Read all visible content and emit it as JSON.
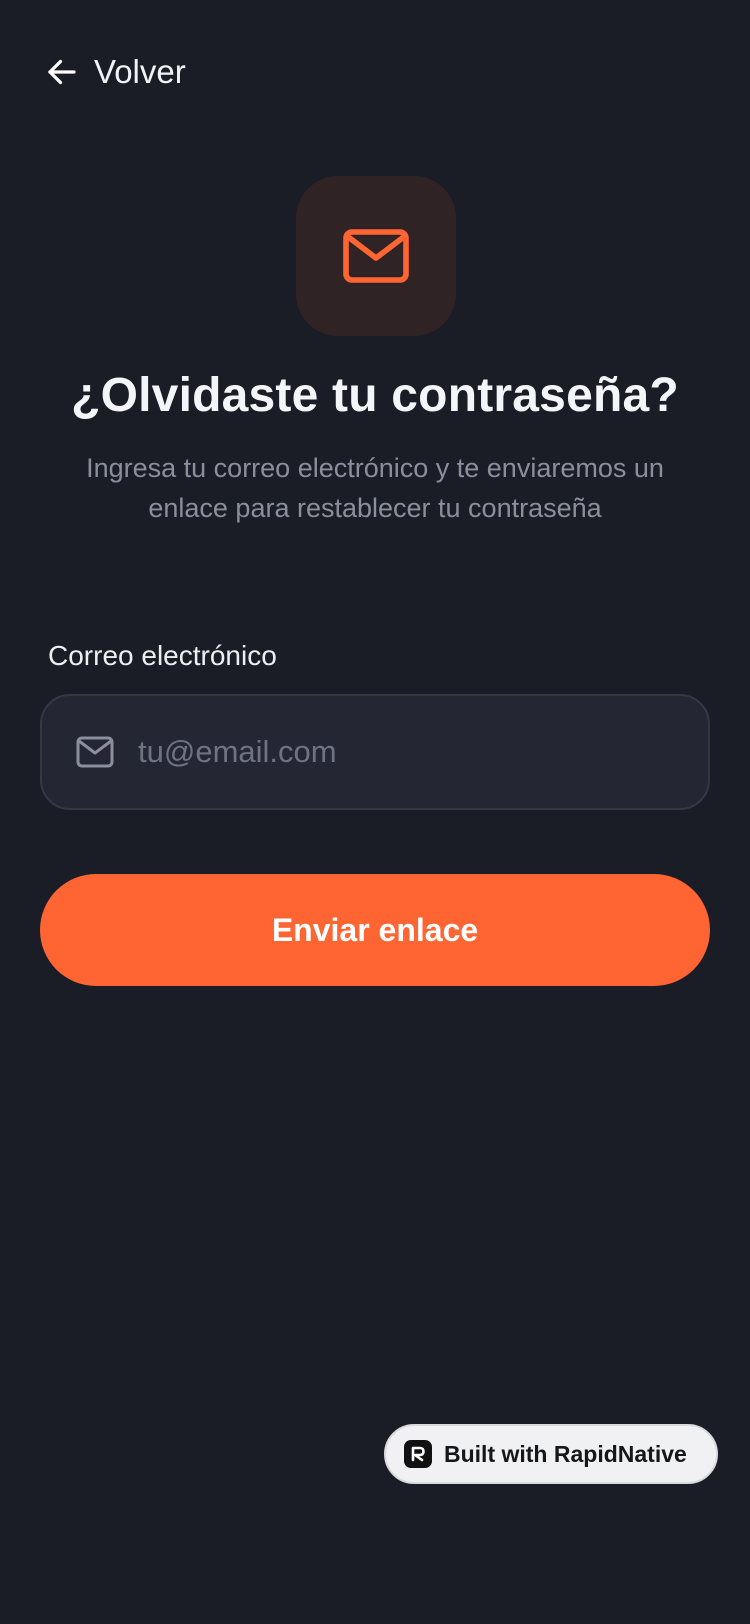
{
  "header": {
    "back_label": "Volver",
    "back_icon": "arrow-left-icon"
  },
  "hero": {
    "icon": "mail-icon",
    "title": "¿Olvidaste tu contraseña?",
    "subtitle": "Ingresa tu correo electrónico y te enviaremos un enlace para restablecer tu contraseña"
  },
  "form": {
    "email_label": "Correo electrónico",
    "email_icon": "mail-outline-icon",
    "email_value": "",
    "email_placeholder": "tu@email.com",
    "submit_label": "Enviar enlace"
  },
  "badge": {
    "label": "Built with RapidNative",
    "logo_letter": "R"
  },
  "colors": {
    "background": "#1b1d26",
    "accent": "#ff6533",
    "hero_icon_bg": "#302326",
    "input_bg": "#242733",
    "muted_text": "#8a8f9e"
  }
}
